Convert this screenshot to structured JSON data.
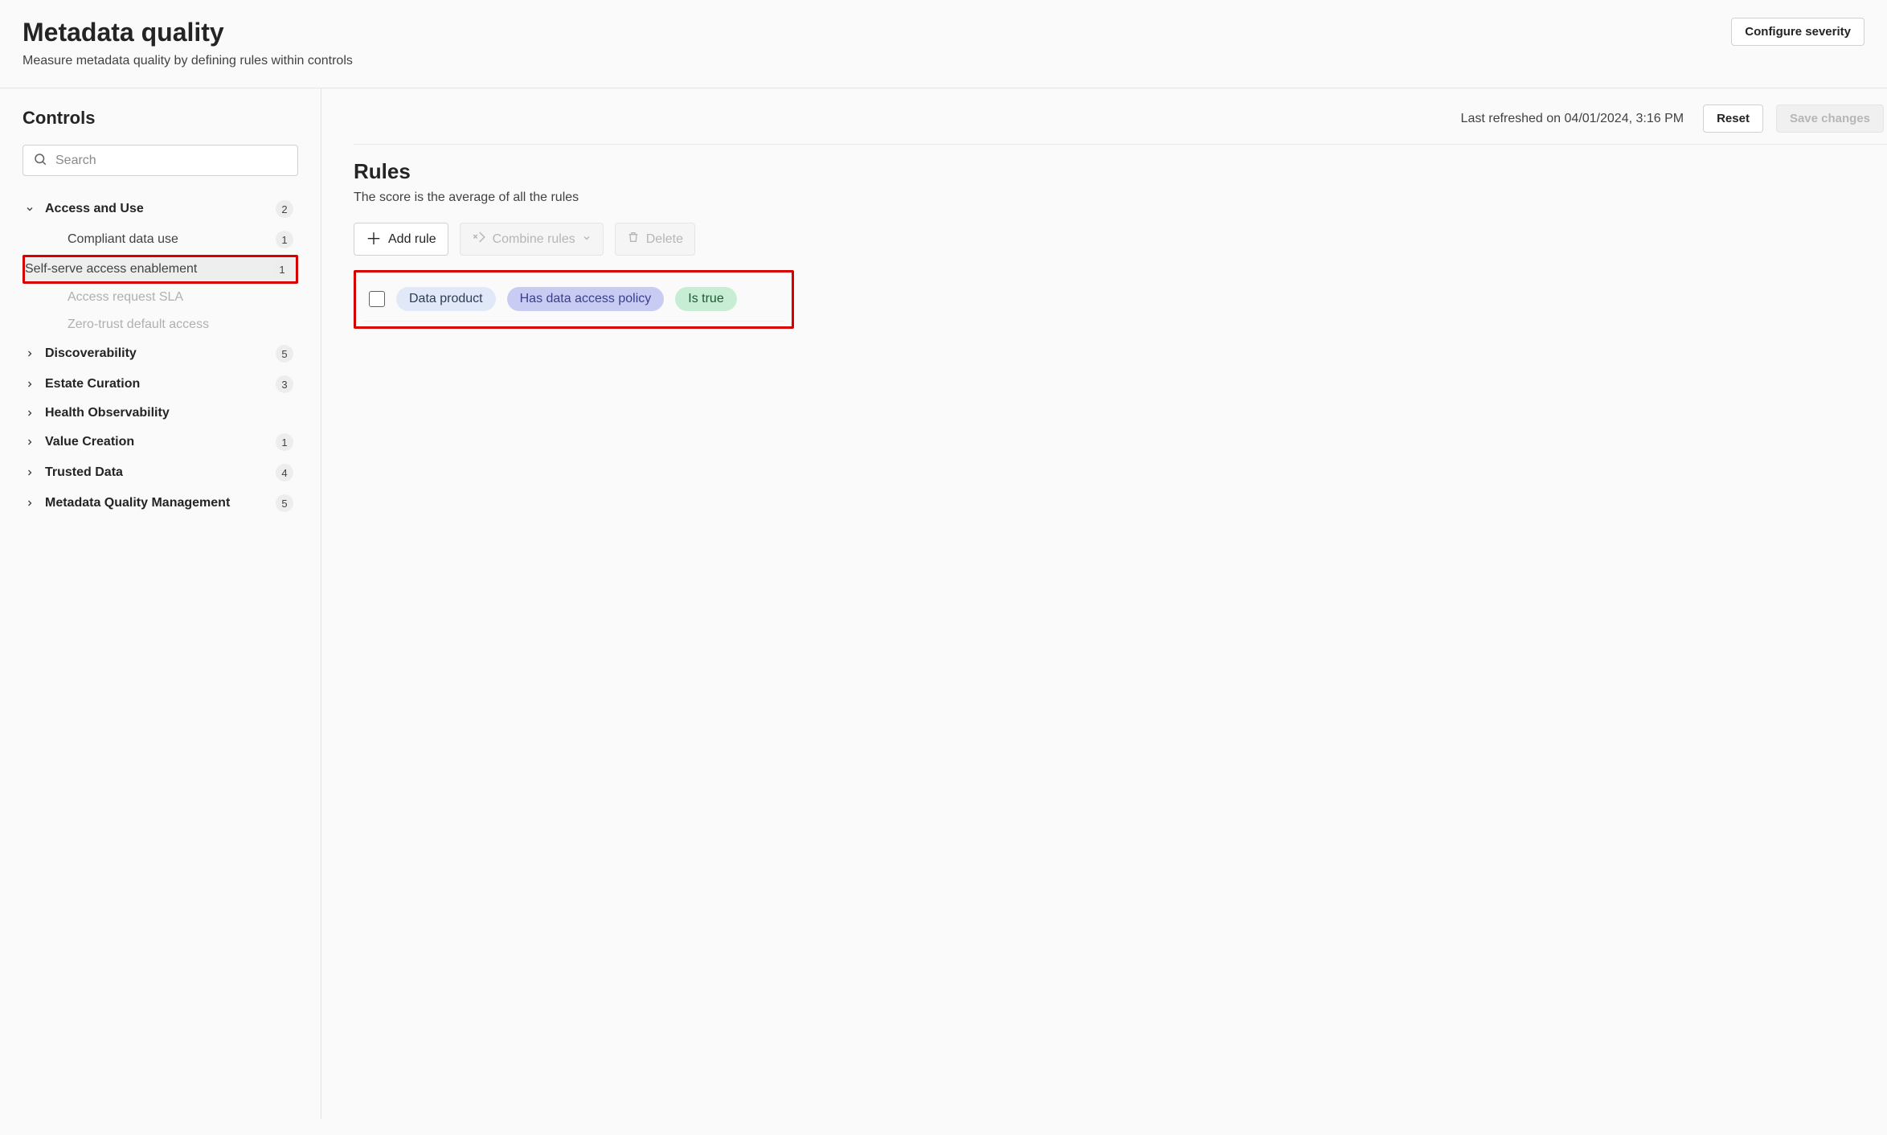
{
  "header": {
    "title": "Metadata quality",
    "subtitle": "Measure metadata quality by defining rules within controls",
    "configure_btn": "Configure severity"
  },
  "sidebar": {
    "title": "Controls",
    "search_placeholder": "Search",
    "groups": [
      {
        "label": "Access and Use",
        "badge": "2",
        "expanded": true,
        "children": [
          {
            "label": "Compliant data use",
            "badge": "1",
            "selected": false
          },
          {
            "label": "Self-serve access enablement",
            "badge": "1",
            "selected": true,
            "highlighted": true
          },
          {
            "label": "Access request SLA",
            "disabled": true
          },
          {
            "label": "Zero-trust default access",
            "disabled": true
          }
        ]
      },
      {
        "label": "Discoverability",
        "badge": "5"
      },
      {
        "label": "Estate Curation",
        "badge": "3"
      },
      {
        "label": "Health Observability"
      },
      {
        "label": "Value Creation",
        "badge": "1"
      },
      {
        "label": "Trusted Data",
        "badge": "4"
      },
      {
        "label": "Metadata Quality Management",
        "badge": "5"
      }
    ]
  },
  "main": {
    "refreshed": "Last refreshed on 04/01/2024, 3:16 PM",
    "reset_btn": "Reset",
    "save_btn": "Save changes",
    "rules_title": "Rules",
    "rules_sub": "The score is the average of all the rules",
    "toolbar": {
      "add": "Add rule",
      "combine": "Combine rules",
      "delete": "Delete"
    },
    "rules": [
      {
        "pills": [
          {
            "text": "Data product",
            "cls": "pill-blue"
          },
          {
            "text": "Has data access policy",
            "cls": "pill-purple"
          },
          {
            "text": "Is true",
            "cls": "pill-green"
          }
        ]
      }
    ]
  }
}
